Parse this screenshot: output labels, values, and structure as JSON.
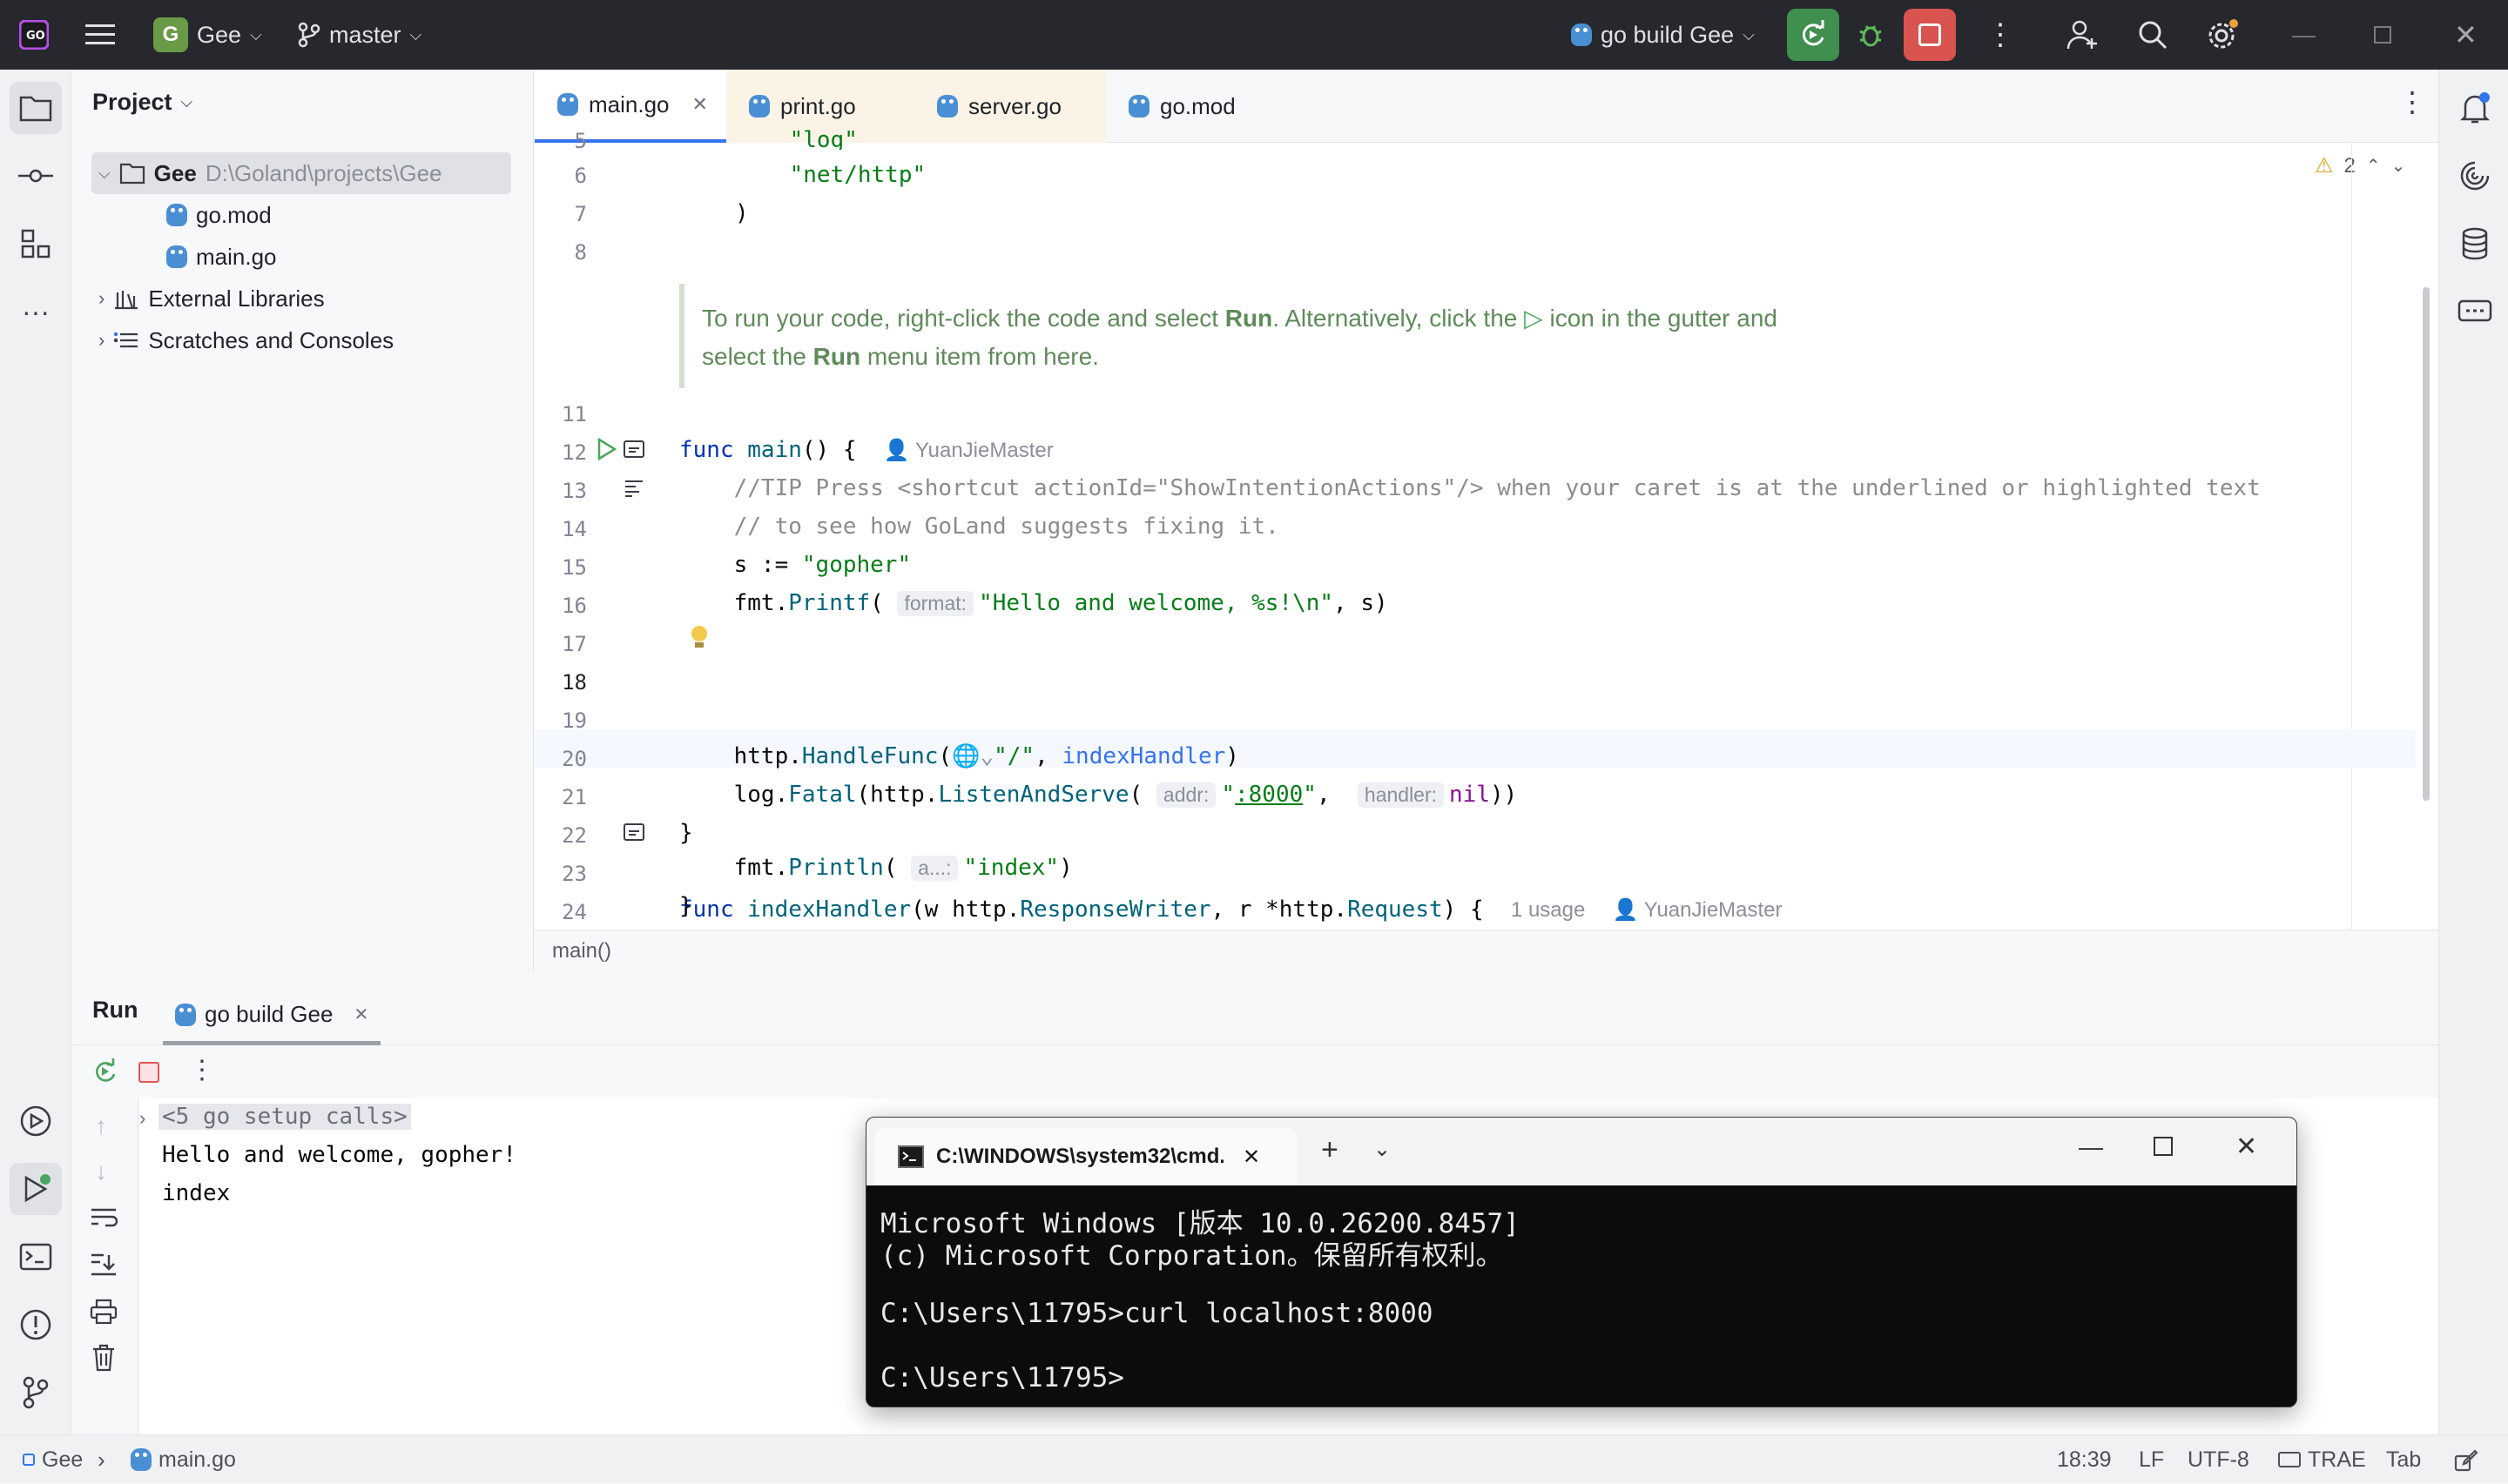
{
  "titlebar": {
    "project_initial": "G",
    "project_name": "Gee",
    "branch": "master",
    "run_config": "go build Gee"
  },
  "project_panel": {
    "title": "Project",
    "root_name": "Gee",
    "root_path": "D:\\Goland\\projects\\Gee",
    "files": [
      "go.mod",
      "main.go"
    ],
    "external_libraries": "External Libraries",
    "scratches": "Scratches and Consoles"
  },
  "editor": {
    "tabs": [
      "main.go",
      "print.go",
      "server.go",
      "go.mod"
    ],
    "warning_count": "2",
    "tip_line1_a": "To run your code, right-click the code and select ",
    "tip_line1_run": "Run",
    "tip_line1_b": ". Alternatively, click the ",
    "tip_line1_c": " icon in the gutter and",
    "tip_line2_a": "select the ",
    "tip_line2_run": "Run",
    "tip_line2_b": " menu item from here.",
    "breadcrumb": "main()",
    "line_numbers": [
      "5",
      "6",
      "7",
      "8",
      "11",
      "12",
      "13",
      "14",
      "15",
      "16",
      "17",
      "18",
      "19",
      "20",
      "21",
      "22",
      "23",
      "24"
    ],
    "author": "YuanJieMaster",
    "usages": "1 usage",
    "hints": {
      "format": "format:",
      "addr": "addr:",
      "handler": "handler:",
      "a": "a...:"
    }
  },
  "run_panel": {
    "title": "Run",
    "tab": "go build Gee",
    "console": [
      "<5 go setup calls>",
      "Hello and welcome, gopher!",
      "index"
    ]
  },
  "cmd": {
    "tab_title": "C:\\WINDOWS\\system32\\cmd.",
    "lines": [
      "Microsoft Windows [版本 10.0.26200.8457]",
      "(c) Microsoft Corporation。保留所有权利。",
      "",
      "C:\\Users\\11795>curl localhost:8000",
      "",
      "C:\\Users\\11795>"
    ]
  },
  "statusbar": {
    "project": "Gee",
    "file": "main.go",
    "position": "18:39",
    "line_sep": "LF",
    "encoding": "UTF-8",
    "plugin": "TRAE",
    "indent": "Tab"
  },
  "colors": {
    "accent": "#3574f0",
    "run_green": "#4aa55e",
    "stop_red": "#e05555"
  }
}
